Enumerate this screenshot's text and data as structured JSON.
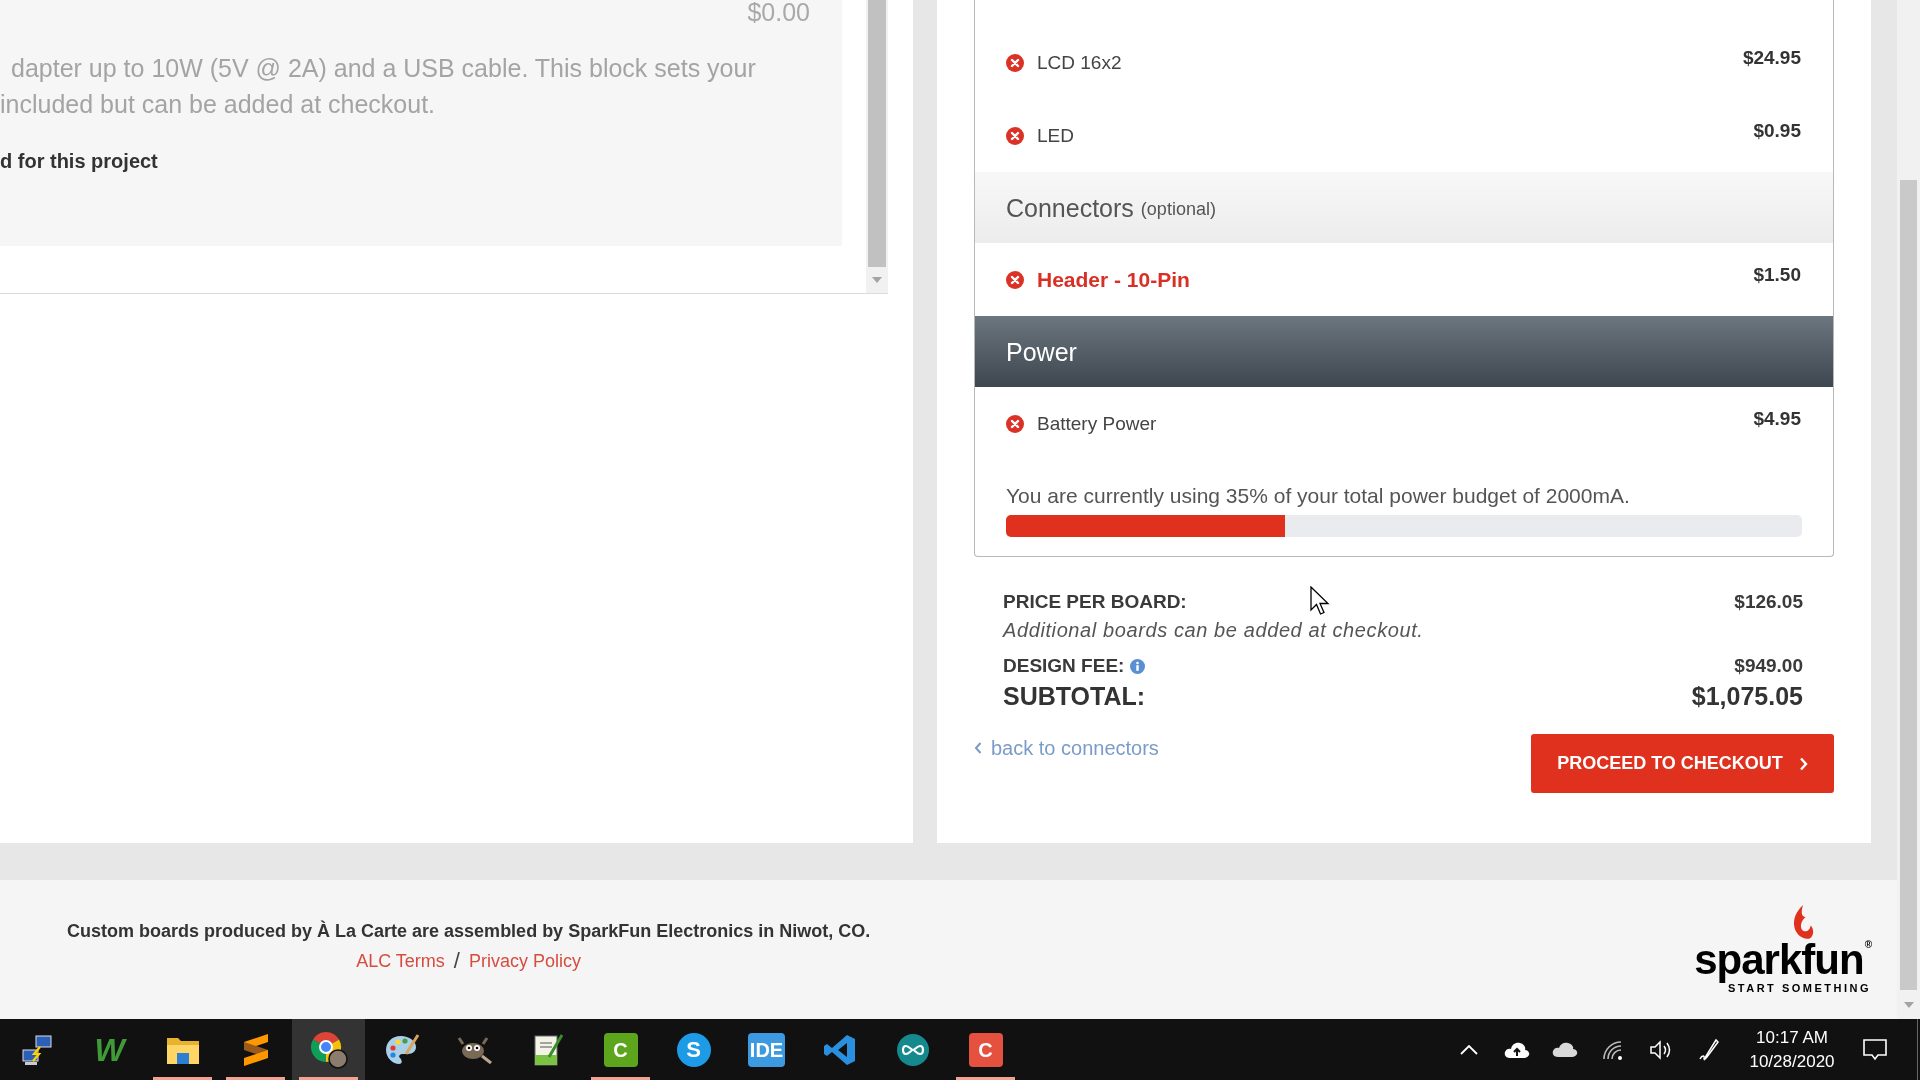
{
  "left_panel": {
    "price": "$0.00",
    "description_lines": [
      "dapter up to 10W (5V @ 2A) and a USB cable. This block sets your",
      "included but can be added at checkout."
    ],
    "note": "d for this project"
  },
  "parts": {
    "groups": [
      {
        "items": [
          {
            "name": "LCD 16x2",
            "price": "$24.95",
            "highlighted": false
          },
          {
            "name": "LED",
            "price": "$0.95",
            "highlighted": false
          }
        ]
      },
      {
        "title": "Connectors",
        "note": "(optional)",
        "active": false,
        "items": [
          {
            "name": "Header - 10-Pin",
            "price": "$1.50",
            "highlighted": true
          }
        ]
      },
      {
        "title": "Power",
        "active": true,
        "items": [
          {
            "name": "Battery Power",
            "price": "$4.95",
            "highlighted": false
          }
        ],
        "budget": {
          "text": "You are currently using 35% of your total power budget of 2000mA.",
          "level": 0.35
        }
      }
    ]
  },
  "summary": {
    "rows": [
      {
        "kind": "price",
        "label": "PRICE PER BOARD:",
        "value": "$126.05",
        "note": "Additional boards can be added at checkout."
      },
      {
        "kind": "fee",
        "label": "DESIGN FEE:",
        "value": "$949.00",
        "info": true
      },
      {
        "kind": "total",
        "label": "SUBTOTAL:",
        "value": "$1,075.05"
      }
    ],
    "back_link": "back to connectors",
    "checkout_button": "PROCEED TO CHECKOUT"
  },
  "footer": {
    "text": "Custom boards produced by À La Carte are assembled by SparkFun Electronics in Niwot, CO.",
    "links": [
      "ALC Terms",
      "Privacy Policy"
    ],
    "separator": "/",
    "logo": {
      "name": "sparkfun",
      "mark": "®",
      "tagline": "START SOMETHING"
    }
  },
  "taskbar": {
    "apps": [
      {
        "kind": "network",
        "running": false,
        "selected": false
      },
      {
        "kind": "letter",
        "glyph": "W",
        "color": "#3f9b35",
        "running": false,
        "selected": false
      },
      {
        "kind": "folder",
        "running": true,
        "selected": false
      },
      {
        "kind": "zigzag",
        "running": true,
        "selected": false
      },
      {
        "kind": "browser",
        "running": true,
        "selected": true
      },
      {
        "kind": "palette",
        "running": false,
        "selected": false
      },
      {
        "kind": "mascot",
        "running": false,
        "selected": false
      },
      {
        "kind": "notepad",
        "running": false,
        "selected": false
      },
      {
        "kind": "tile",
        "glyph": "C",
        "color": "#5da51c",
        "running": true,
        "selected": false
      },
      {
        "kind": "disc",
        "glyph": "S",
        "color": "#1d9be6",
        "running": false,
        "selected": false
      },
      {
        "kind": "tile",
        "glyph": "IDE",
        "color": "#3d9ae0",
        "running": false,
        "selected": false
      },
      {
        "kind": "ribbon",
        "running": false,
        "selected": false
      },
      {
        "kind": "infinity",
        "running": false,
        "selected": false
      },
      {
        "kind": "tile",
        "glyph": "C",
        "color": "#e4513f",
        "running": true,
        "selected": false
      }
    ],
    "clock": {
      "time": "10:17 AM",
      "date": "10/28/2020"
    }
  }
}
